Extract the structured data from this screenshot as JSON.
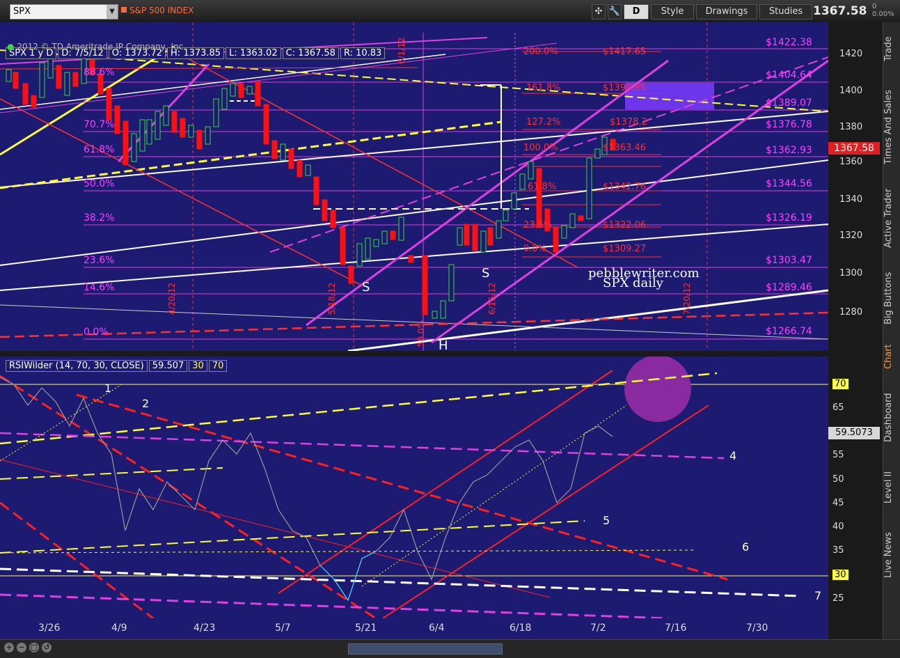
{
  "toolbar": {
    "symbol": "SPX",
    "index_name": "S&P 500 INDEX",
    "d_label": "D",
    "style_label": "Style",
    "drawings_label": "Drawings",
    "studies_label": "Studies",
    "last_price": "1367.58",
    "change_top": "0",
    "change_pct": "0.00%"
  },
  "chart_header": {
    "symbol_period": "SPX 1 y D",
    "date": "D: 7/5/12",
    "open": "O: 1373.72",
    "high": "H: 1373.85",
    "low": "L: 1363.02",
    "close": "C: 1367.58",
    "range": "R: 10.83",
    "copyright": "2012 © TD Ameritrade IP Company, Inc."
  },
  "price_scale": {
    "ticks": [
      "1420",
      "1400",
      "1380",
      "1360",
      "1340",
      "1320",
      "1300",
      "1280"
    ],
    "current_badge": "1367.58"
  },
  "fib_levels_left": [
    "88.6%",
    "70.7%",
    "61.8%",
    "50.0%",
    "38.2%",
    "23.6%",
    "14.6%",
    "0.0%"
  ],
  "fib_values_right": [
    "$1422.38",
    "$1404.64",
    "$1389.07",
    "$1376.78",
    "$1362.93",
    "$1344.56",
    "$1326.19",
    "$1303.47",
    "$1289.46",
    "$1266.74"
  ],
  "fib_ext_pcts": [
    "200.0%",
    "161.8%",
    "127.2%",
    "100.0%",
    "61.8%",
    "23.6%",
    "0.0%"
  ],
  "fib_ext_values": [
    "$1417.65",
    "$1398.85",
    "$1378.2",
    "$1363.46",
    "$1342.76",
    "$1322.06",
    "$1309.27"
  ],
  "vertical_dates": [
    "4/20/12",
    "5/18/12",
    "6/1/12",
    "6/15/12",
    "7/20/12"
  ],
  "pattern_labels": {
    "left_shoulder": "S",
    "head": "H",
    "right_shoulder": "S",
    "h_pct": "50.0%",
    "low_pct": "0.0%"
  },
  "watermark": {
    "site": "pebblewriter.com",
    "caption": "SPX daily"
  },
  "rsi": {
    "study": "RSIWilder (14, 70, 30, CLOSE)",
    "value": "59.507",
    "ob": "30",
    "os": "70",
    "ticks": [
      "70",
      "65",
      "60",
      "55",
      "50",
      "45",
      "40",
      "35",
      "30",
      "25"
    ],
    "current_badge": "59.5073",
    "line_labels": [
      "1",
      "2",
      "4",
      "5",
      "6",
      "7"
    ]
  },
  "x_axis": [
    "3/26",
    "4/9",
    "4/23",
    "5/7",
    "5/21",
    "6/4",
    "6/18",
    "7/2",
    "7/16",
    "7/30"
  ],
  "sidebar_tabs": [
    "Trade",
    "Times And Sales",
    "Active Trader",
    "Big Buttons",
    "Chart",
    "Dashboard",
    "Level II",
    "Live News"
  ],
  "colors": {
    "panel_bg": "#1d1a72",
    "magenta": "#e040e0",
    "red": "#ff2020",
    "yellow": "#ffff30",
    "white": "#ffffff",
    "bull_candle": "#33dd33",
    "bear_candle": "#ff1010",
    "active_tab": "#ff9a2e"
  }
}
